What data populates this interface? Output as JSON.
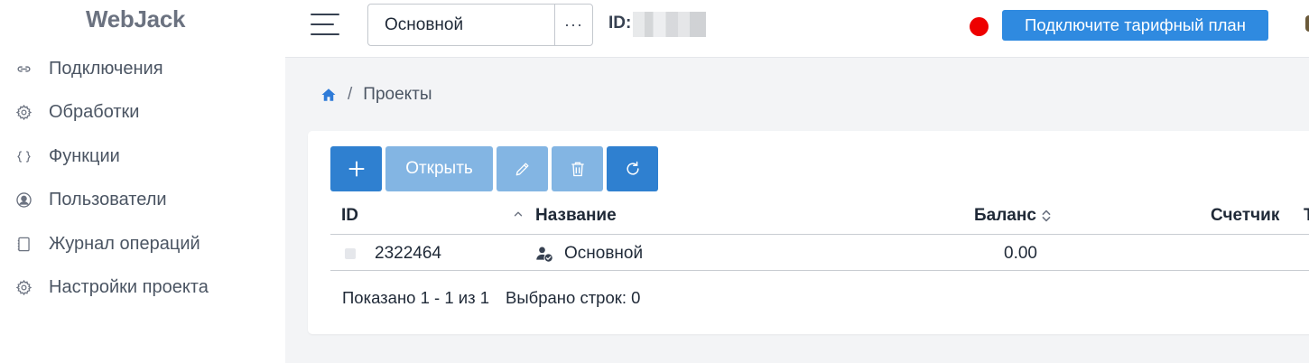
{
  "brand": "WebJack",
  "sidebar": {
    "items": [
      {
        "label": "Подключения",
        "icon": "link-icon"
      },
      {
        "label": "Обработки",
        "icon": "gear-icon"
      },
      {
        "label": "Функции",
        "icon": "braces-icon"
      },
      {
        "label": "Пользователи",
        "icon": "user-circle-icon"
      },
      {
        "label": "Журнал операций",
        "icon": "journal-icon"
      },
      {
        "label": "Настройки проекта",
        "icon": "gear-icon"
      }
    ]
  },
  "header": {
    "project_select": {
      "value": "Основной",
      "more_label": "···"
    },
    "id_label": "ID:",
    "status_color": "#ee0000",
    "plan_button": "Подключите тарифный план"
  },
  "breadcrumb": {
    "separator": "/",
    "current": "Проекты"
  },
  "toolbar": {
    "open_label": "Открыть"
  },
  "table": {
    "columns": {
      "id": "ID",
      "name": "Название",
      "balance": "Баланс",
      "counter": "Счетчик",
      "next": "Т"
    },
    "rows": [
      {
        "id": "2322464",
        "name": "Основной",
        "balance": "0.00"
      }
    ]
  },
  "footer": {
    "shown": "Показано 1 - 1 из 1",
    "selected": "Выбрано строк: 0"
  },
  "colors": {
    "primary": "#2f80d0",
    "primary_disabled": "#83b5e3",
    "plan_button": "#2f8ae0"
  }
}
